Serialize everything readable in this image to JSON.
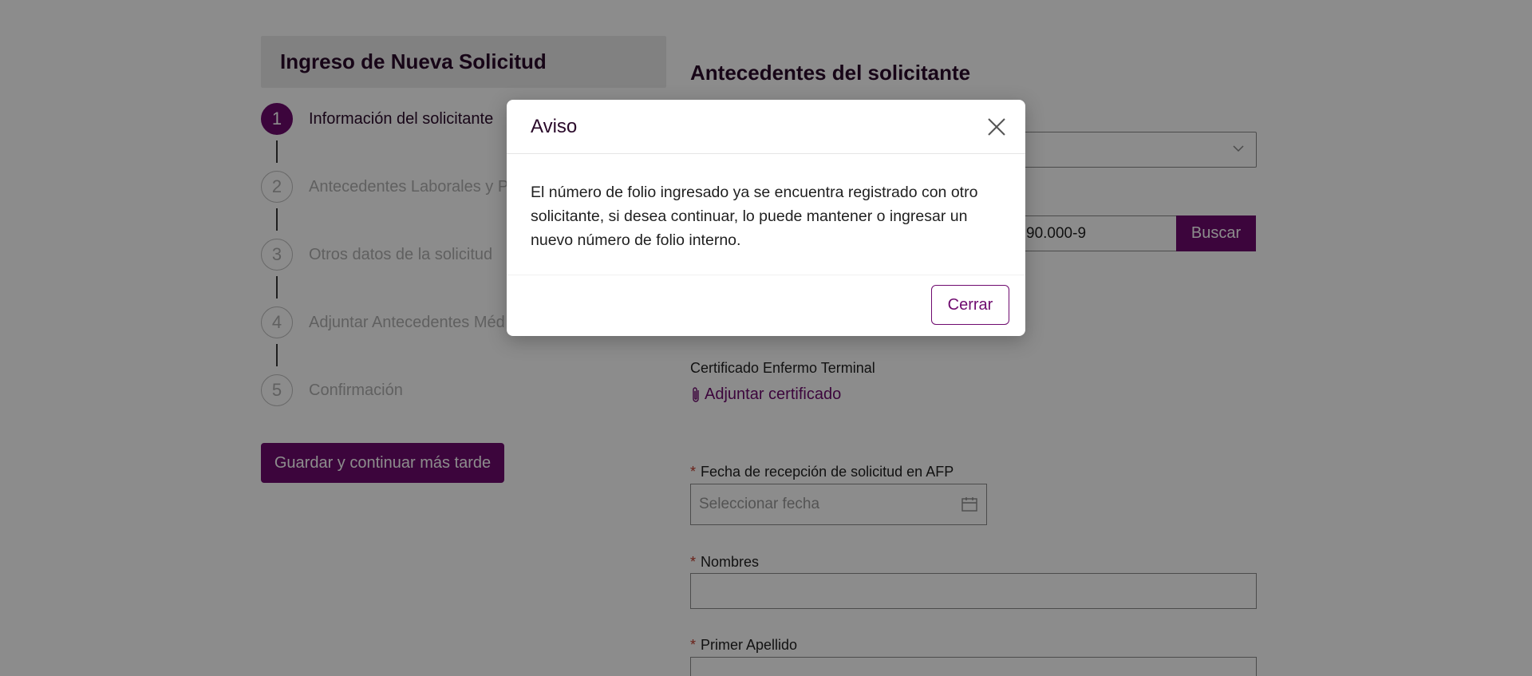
{
  "left_panel": {
    "title": "Ingreso de Nueva Solicitud",
    "steps": [
      {
        "number": "1",
        "label": "Información del solicitante",
        "active": true
      },
      {
        "number": "2",
        "label": "Antecedentes Laborales y Pr"
      },
      {
        "number": "3",
        "label": "Otros datos de la solicitud"
      },
      {
        "number": "4",
        "label": "Adjuntar Antecedentes Méd"
      },
      {
        "number": "5",
        "label": "Confirmación"
      }
    ],
    "save_later_label": "Guardar y continuar más tarde"
  },
  "form": {
    "title": "Antecedentes del solicitante",
    "folio_value": "90.000-9",
    "search_label": "Buscar",
    "certificate_label": "Certificado Enfermo Terminal",
    "attach_label": "Adjuntar certificado",
    "reception_date": {
      "required_mark": "*",
      "label": "Fecha de recepción de solicitud en AFP",
      "placeholder": "Seleccionar fecha"
    },
    "names": {
      "required_mark": "*",
      "label": "Nombres"
    },
    "first_surname": {
      "required_mark": "*",
      "label": "Primer Apellido"
    }
  },
  "modal": {
    "title": "Aviso",
    "message": "El número de folio ingresado ya se encuentra registrado con otro solicitante, si desea continuar, lo puede mantener o ingresar un nuevo número de folio interno.",
    "close_label": "Cerrar"
  },
  "colors": {
    "brand": "#6e0a6e",
    "overlay": "rgba(0,0,0,0.45)"
  }
}
